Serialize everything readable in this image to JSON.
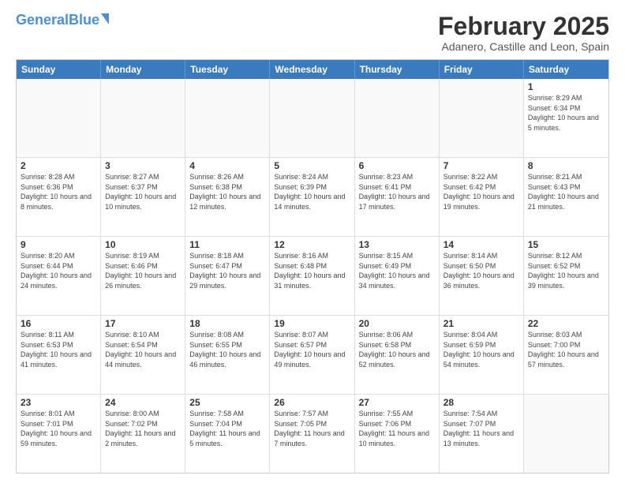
{
  "header": {
    "logo_general": "General",
    "logo_blue": "Blue",
    "month_title": "February 2025",
    "location": "Adanero, Castille and Leon, Spain"
  },
  "calendar": {
    "days_of_week": [
      "Sunday",
      "Monday",
      "Tuesday",
      "Wednesday",
      "Thursday",
      "Friday",
      "Saturday"
    ],
    "weeks": [
      [
        {
          "day": "",
          "info": ""
        },
        {
          "day": "",
          "info": ""
        },
        {
          "day": "",
          "info": ""
        },
        {
          "day": "",
          "info": ""
        },
        {
          "day": "",
          "info": ""
        },
        {
          "day": "",
          "info": ""
        },
        {
          "day": "1",
          "info": "Sunrise: 8:29 AM\nSunset: 6:34 PM\nDaylight: 10 hours and 5 minutes."
        }
      ],
      [
        {
          "day": "2",
          "info": "Sunrise: 8:28 AM\nSunset: 6:36 PM\nDaylight: 10 hours and 8 minutes."
        },
        {
          "day": "3",
          "info": "Sunrise: 8:27 AM\nSunset: 6:37 PM\nDaylight: 10 hours and 10 minutes."
        },
        {
          "day": "4",
          "info": "Sunrise: 8:26 AM\nSunset: 6:38 PM\nDaylight: 10 hours and 12 minutes."
        },
        {
          "day": "5",
          "info": "Sunrise: 8:24 AM\nSunset: 6:39 PM\nDaylight: 10 hours and 14 minutes."
        },
        {
          "day": "6",
          "info": "Sunrise: 8:23 AM\nSunset: 6:41 PM\nDaylight: 10 hours and 17 minutes."
        },
        {
          "day": "7",
          "info": "Sunrise: 8:22 AM\nSunset: 6:42 PM\nDaylight: 10 hours and 19 minutes."
        },
        {
          "day": "8",
          "info": "Sunrise: 8:21 AM\nSunset: 6:43 PM\nDaylight: 10 hours and 21 minutes."
        }
      ],
      [
        {
          "day": "9",
          "info": "Sunrise: 8:20 AM\nSunset: 6:44 PM\nDaylight: 10 hours and 24 minutes."
        },
        {
          "day": "10",
          "info": "Sunrise: 8:19 AM\nSunset: 6:46 PM\nDaylight: 10 hours and 26 minutes."
        },
        {
          "day": "11",
          "info": "Sunrise: 8:18 AM\nSunset: 6:47 PM\nDaylight: 10 hours and 29 minutes."
        },
        {
          "day": "12",
          "info": "Sunrise: 8:16 AM\nSunset: 6:48 PM\nDaylight: 10 hours and 31 minutes."
        },
        {
          "day": "13",
          "info": "Sunrise: 8:15 AM\nSunset: 6:49 PM\nDaylight: 10 hours and 34 minutes."
        },
        {
          "day": "14",
          "info": "Sunrise: 8:14 AM\nSunset: 6:50 PM\nDaylight: 10 hours and 36 minutes."
        },
        {
          "day": "15",
          "info": "Sunrise: 8:12 AM\nSunset: 6:52 PM\nDaylight: 10 hours and 39 minutes."
        }
      ],
      [
        {
          "day": "16",
          "info": "Sunrise: 8:11 AM\nSunset: 6:53 PM\nDaylight: 10 hours and 41 minutes."
        },
        {
          "day": "17",
          "info": "Sunrise: 8:10 AM\nSunset: 6:54 PM\nDaylight: 10 hours and 44 minutes."
        },
        {
          "day": "18",
          "info": "Sunrise: 8:08 AM\nSunset: 6:55 PM\nDaylight: 10 hours and 46 minutes."
        },
        {
          "day": "19",
          "info": "Sunrise: 8:07 AM\nSunset: 6:57 PM\nDaylight: 10 hours and 49 minutes."
        },
        {
          "day": "20",
          "info": "Sunrise: 8:06 AM\nSunset: 6:58 PM\nDaylight: 10 hours and 52 minutes."
        },
        {
          "day": "21",
          "info": "Sunrise: 8:04 AM\nSunset: 6:59 PM\nDaylight: 10 hours and 54 minutes."
        },
        {
          "day": "22",
          "info": "Sunrise: 8:03 AM\nSunset: 7:00 PM\nDaylight: 10 hours and 57 minutes."
        }
      ],
      [
        {
          "day": "23",
          "info": "Sunrise: 8:01 AM\nSunset: 7:01 PM\nDaylight: 10 hours and 59 minutes."
        },
        {
          "day": "24",
          "info": "Sunrise: 8:00 AM\nSunset: 7:02 PM\nDaylight: 11 hours and 2 minutes."
        },
        {
          "day": "25",
          "info": "Sunrise: 7:58 AM\nSunset: 7:04 PM\nDaylight: 11 hours and 5 minutes."
        },
        {
          "day": "26",
          "info": "Sunrise: 7:57 AM\nSunset: 7:05 PM\nDaylight: 11 hours and 7 minutes."
        },
        {
          "day": "27",
          "info": "Sunrise: 7:55 AM\nSunset: 7:06 PM\nDaylight: 11 hours and 10 minutes."
        },
        {
          "day": "28",
          "info": "Sunrise: 7:54 AM\nSunset: 7:07 PM\nDaylight: 11 hours and 13 minutes."
        },
        {
          "day": "",
          "info": ""
        }
      ]
    ]
  }
}
